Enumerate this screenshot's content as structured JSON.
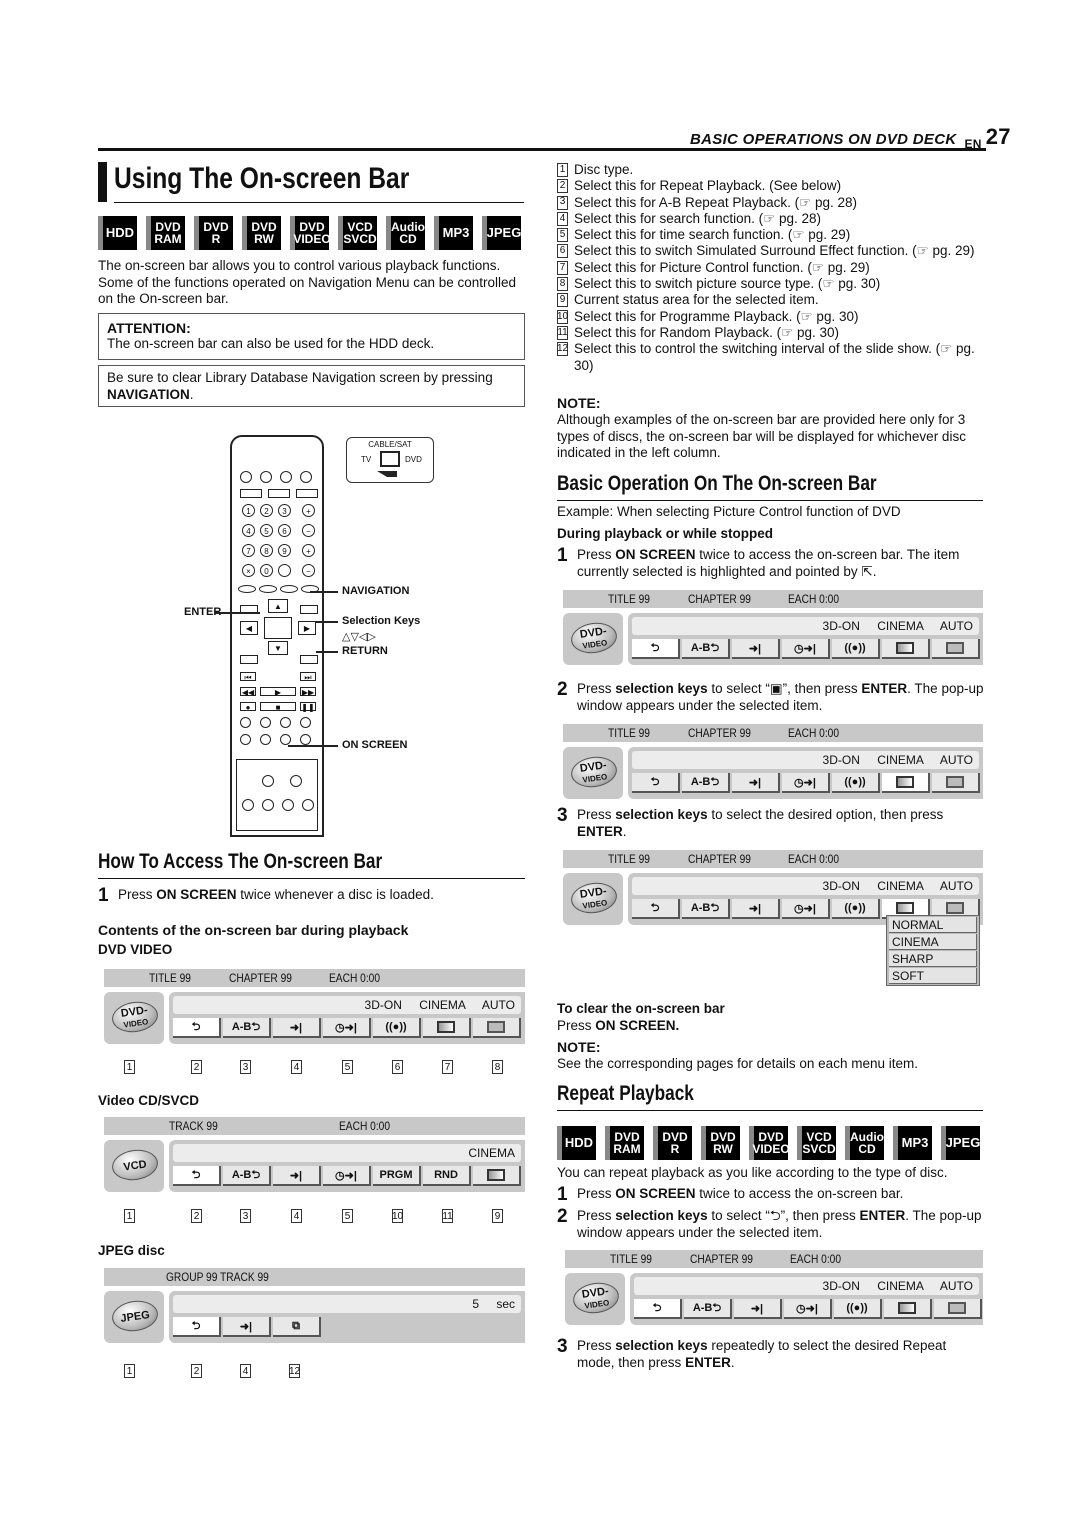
{
  "header": {
    "section": "BASIC OPERATIONS ON DVD DECK",
    "lang": "EN",
    "page": "27"
  },
  "title": "Using The On-screen Bar",
  "disc_badges": [
    {
      "l1": "HDD",
      "l2": ""
    },
    {
      "l1": "DVD",
      "l2": "RAM"
    },
    {
      "l1": "DVD",
      "l2": "R"
    },
    {
      "l1": "DVD",
      "l2": "RW"
    },
    {
      "l1": "DVD",
      "l2": "VIDEO"
    },
    {
      "l1": "VCD",
      "l2": "SVCD"
    },
    {
      "l1": "Audio",
      "l2": "CD"
    },
    {
      "l1": "MP3",
      "l2": ""
    },
    {
      "l1": "JPEG",
      "l2": ""
    }
  ],
  "intro": "The on-screen bar allows you to control various playback functions. Some of the functions operated on Navigation Menu can be controlled on the On-screen bar.",
  "attention": {
    "title": "ATTENTION:",
    "text": "The on-screen bar can also be used for the HDD deck."
  },
  "navigation_note": {
    "text": "Be sure to clear Library Database Navigation screen by pressing",
    "bold": "NAVIGATION",
    "end": "."
  },
  "remote": {
    "switch_label": "CABLE/SAT",
    "switch_left": "TV",
    "switch_right": "DVD",
    "labels": {
      "enter": "ENTER",
      "navigation": "NAVIGATION",
      "selection_keys": "Selection Keys",
      "arrows": "△▽◁▷",
      "return": "RETURN",
      "on_screen": "ON SCREEN"
    },
    "keypad": [
      "1",
      "2",
      "3",
      "4",
      "5",
      "6",
      "7",
      "8",
      "9",
      "×",
      "0",
      ""
    ]
  },
  "access": {
    "heading": "How To Access The On-screen Bar",
    "step1_pre": "Press ",
    "step1_bold": "ON SCREEN",
    "step1_post": " twice whenever a disc is loaded.",
    "contents_heading": "Contents of the on-screen bar during playback",
    "dvd_label": "DVD VIDEO",
    "vcd_label": "Video CD/SVCD",
    "jpeg_label": "JPEG disc"
  },
  "bars": {
    "dvd": {
      "top": [
        "TITLE 99",
        "CHAPTER 99",
        "EACH 0:00"
      ],
      "disc": [
        "DVD-",
        "VIDEO"
      ],
      "status": "3D-ON CINEMA AUTO",
      "buttons": [
        "repeat",
        "A-B",
        "search",
        "time-search",
        "surround",
        "picture",
        "source"
      ],
      "callouts": [
        "1",
        "2",
        "3",
        "4",
        "5",
        "6",
        "7",
        "8"
      ]
    },
    "vcd": {
      "top": [
        "TRACK 99",
        "EACH 0:00"
      ],
      "disc": [
        "VCD",
        ""
      ],
      "status": "CINEMA",
      "buttons": [
        "repeat",
        "A-B",
        "search",
        "time-search",
        "PRGM",
        "RND",
        "picture"
      ],
      "callouts": [
        "1",
        "2",
        "3",
        "4",
        "5",
        "10",
        "11",
        "9"
      ]
    },
    "jpeg": {
      "top": [
        "GROUP 99   TRACK 99"
      ],
      "disc": [
        "JPEG",
        ""
      ],
      "status": "5 sec",
      "buttons": [
        "repeat",
        "search",
        "slideshow"
      ],
      "callouts": [
        "1",
        "2",
        "4",
        "12"
      ]
    }
  },
  "legend": [
    {
      "n": "1",
      "text": "Disc type."
    },
    {
      "n": "2",
      "text": "Select this for Repeat Playback. (See below)"
    },
    {
      "n": "3",
      "text": "Select this for A-B Repeat Playback. (☞ pg. 28)"
    },
    {
      "n": "4",
      "text": "Select this for search function. (☞ pg. 28)"
    },
    {
      "n": "5",
      "text": "Select this for time search function. (☞ pg. 29)"
    },
    {
      "n": "6",
      "text": "Select this to switch Simulated Surround Effect function. (☞ pg. 29)"
    },
    {
      "n": "7",
      "text": "Select this for Picture Control function. (☞ pg. 29)"
    },
    {
      "n": "8",
      "text": "Select this to switch picture source type. (☞ pg. 30)"
    },
    {
      "n": "9",
      "text": "Current status area for the selected item."
    },
    {
      "n": "10",
      "text": "Select this for Programme Playback. (☞ pg. 30)"
    },
    {
      "n": "11",
      "text": "Select this for Random Playback. (☞ pg. 30)"
    },
    {
      "n": "12",
      "text": "Select this to control the switching interval of the slide show. (☞ pg. 30)"
    }
  ],
  "note1": {
    "title": "NOTE:",
    "text": "Although examples of the on-screen bar are provided here only for 3 types of discs, the on-screen bar will be displayed for whichever disc indicated in the left column."
  },
  "basic": {
    "heading": "Basic Operation On The On-screen Bar",
    "example": "Example: When selecting Picture Control function of DVD",
    "sub": "During playback or while stopped",
    "step1": {
      "n": "1",
      "pre": "Press ",
      "bold": "ON SCREEN",
      "post": " twice to access the on-screen bar. The item currently selected is highlighted and pointed by ⇱."
    },
    "step2": {
      "n": "2",
      "pre": "Press ",
      "bold": "selection keys",
      "mid": " to select “▣”, then press ",
      "bold2": "ENTER",
      "post": ". The pop-up window appears under the selected item."
    },
    "step3": {
      "n": "3",
      "pre": "Press ",
      "bold": "selection keys",
      "mid": " to select the desired option, then press ",
      "bold2": "ENTER",
      "post": "."
    },
    "popup": [
      "NORMAL",
      "CINEMA",
      "SHARP",
      "SOFT"
    ],
    "clear_heading": "To clear the on-screen bar",
    "clear_pre": "Press ",
    "clear_bold": "ON SCREEN.",
    "note_title": "NOTE:",
    "note_text": "See the corresponding pages for details on each menu item."
  },
  "repeat": {
    "heading": "Repeat Playback",
    "intro": "You can repeat playback as you like according to the type of disc.",
    "step1": {
      "n": "1",
      "pre": "Press ",
      "bold": "ON SCREEN",
      "post": " twice to access the on-screen bar."
    },
    "step2": {
      "n": "2",
      "pre": "Press ",
      "bold": "selection keys",
      "mid": " to select “⮌”, then press ",
      "bold2": "ENTER",
      "post": ". The pop-up window appears under the selected item."
    },
    "step3": {
      "n": "3",
      "pre": "Press ",
      "bold": "selection keys",
      "mid": " repeatedly to select the desired Repeat mode, then press ",
      "bold2": "ENTER",
      "post": "."
    }
  }
}
